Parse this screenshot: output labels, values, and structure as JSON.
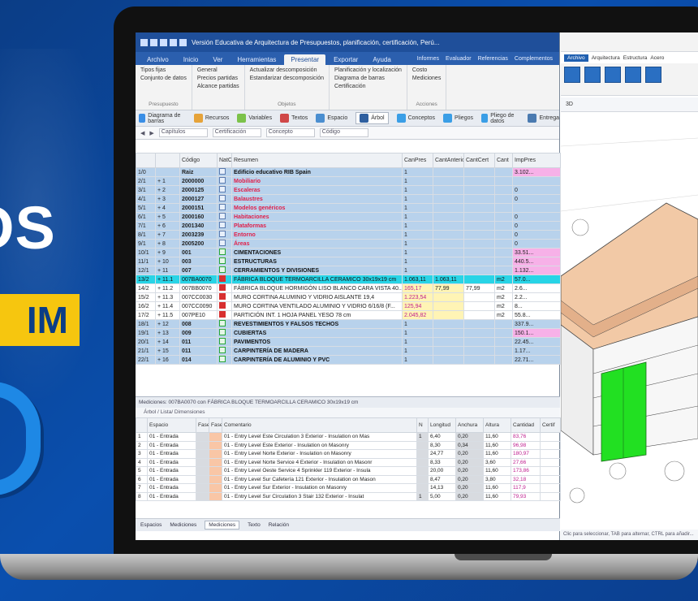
{
  "promo": {
    "headline": "OS",
    "badge": "IM"
  },
  "app": {
    "window_title": "Versión Educativa de Arquitectura de Presupuestos, planificación, certificación, Perú...",
    "menu_tabs": [
      "Archivo",
      "Inicio",
      "Ver",
      "Herramientas",
      "Presentar",
      "Exportar",
      "Ayuda"
    ],
    "active_menu": "Presentar",
    "menu_right": [
      "Informes",
      "Evaluador",
      "Referencias",
      "Complementos"
    ],
    "ribbon_groups": [
      {
        "name": "Presupuesto",
        "items": [
          "Tipos fijas",
          "Conjunto de datos"
        ]
      },
      {
        "name": "",
        "items": [
          "General",
          "Precios partidas",
          "Alcance partidas"
        ]
      },
      {
        "name": "Objetos",
        "items": [
          "Actualizar descomposición",
          "Estandarizar descomposición"
        ]
      },
      {
        "name": "",
        "items": [
          "Planificación y localización",
          "Diagrama de barras",
          "Certificación"
        ]
      },
      {
        "name": "Acciones",
        "items": [
          "Costo",
          "Mediciones"
        ]
      }
    ],
    "doc_tabs": [
      "Diagrama de barras",
      "Recursos",
      "Variables",
      "Textos",
      "Espacio",
      "Árbol",
      "Conceptos",
      "Pliegos",
      "Pliego de datos",
      "Entrega"
    ],
    "active_doc_tab": "Árbol",
    "nav": {
      "field1": "Capítulos",
      "field2": "Certificación",
      "field3": "Concepto",
      "field4": "Código"
    },
    "top_headers": [
      "",
      "",
      "Código",
      "NatC",
      "Resumen",
      "CanPres",
      "CantAnteriorLC",
      "CantCert",
      "Cant",
      "ImpPres"
    ],
    "top_rows": [
      {
        "n": "1/0",
        "lvl": "",
        "code": "Raiz",
        "nat": "blue",
        "desc": "Edificio educativo RIB Spain",
        "style": "chap",
        "txt": "blk",
        "c1": "1",
        "c2": "",
        "c3": "",
        "c4": "",
        "imp": "3.102..."
      },
      {
        "n": "2/1",
        "lvl": "+ 1",
        "code": "2000000",
        "nat": "blue",
        "desc": "Mobiliario",
        "style": "chap",
        "txt": "red",
        "c1": "1",
        "c2": "",
        "c3": "",
        "c4": "",
        "imp": ""
      },
      {
        "n": "3/1",
        "lvl": "+ 2",
        "code": "2000125",
        "nat": "blue",
        "desc": "Escaleras",
        "style": "chap",
        "txt": "red",
        "c1": "1",
        "c2": "",
        "c3": "",
        "c4": "",
        "imp": "0"
      },
      {
        "n": "4/1",
        "lvl": "+ 3",
        "code": "2000127",
        "nat": "blue",
        "desc": "Balaustres",
        "style": "chap",
        "txt": "red",
        "c1": "1",
        "c2": "",
        "c3": "",
        "c4": "",
        "imp": "0"
      },
      {
        "n": "5/1",
        "lvl": "+ 4",
        "code": "2000151",
        "nat": "blue",
        "desc": "Modelos genéricos",
        "style": "chap",
        "txt": "red",
        "c1": "1",
        "c2": "",
        "c3": "",
        "c4": "",
        "imp": ""
      },
      {
        "n": "6/1",
        "lvl": "+ 5",
        "code": "2000160",
        "nat": "blue",
        "desc": "Habitaciones",
        "style": "chap",
        "txt": "red",
        "c1": "1",
        "c2": "",
        "c3": "",
        "c4": "",
        "imp": "0"
      },
      {
        "n": "7/1",
        "lvl": "+ 6",
        "code": "2001340",
        "nat": "blue",
        "desc": "Plataformas",
        "style": "chap",
        "txt": "red",
        "c1": "1",
        "c2": "",
        "c3": "",
        "c4": "",
        "imp": "0"
      },
      {
        "n": "8/1",
        "lvl": "+ 7",
        "code": "2003239",
        "nat": "blue",
        "desc": "Entorno",
        "style": "chap",
        "txt": "red",
        "c1": "1",
        "c2": "",
        "c3": "",
        "c4": "",
        "imp": "0"
      },
      {
        "n": "9/1",
        "lvl": "+ 8",
        "code": "2005200",
        "nat": "blue",
        "desc": "Áreas",
        "style": "chap",
        "txt": "red",
        "c1": "1",
        "c2": "",
        "c3": "",
        "c4": "",
        "imp": "0"
      },
      {
        "n": "10/1",
        "lvl": "+ 9",
        "code": "001",
        "nat": "green",
        "desc": "CIMENTACIONES",
        "style": "chap",
        "txt": "blk",
        "c1": "1",
        "c2": "",
        "c3": "",
        "c4": "",
        "imp": "33.51..."
      },
      {
        "n": "11/1",
        "lvl": "+ 10",
        "code": "003",
        "nat": "green",
        "desc": "ESTRUCTURAS",
        "style": "chap",
        "txt": "blk",
        "c1": "1",
        "c2": "",
        "c3": "",
        "c4": "",
        "imp": "440.5..."
      },
      {
        "n": "12/1",
        "lvl": "+ 11",
        "code": "007",
        "nat": "green",
        "desc": "CERRAMIENTOS Y DIVISIONES",
        "style": "chap",
        "txt": "blk",
        "c1": "1",
        "c2": "",
        "c3": "",
        "c4": "",
        "imp": "1.132..."
      },
      {
        "n": "13/2",
        "lvl": "+ 11.1",
        "code": "007BA0070",
        "nat": "red",
        "desc": "FÁBRICA BLOQUE TERMOARCILLA CERAMICO 30x19x19 cm",
        "style": "sel",
        "txt": "",
        "c1": "1.063,11",
        "c2": "1.063,11",
        "c3": "",
        "c4": "m2",
        "imp": "57.0..."
      },
      {
        "n": "14/2",
        "lvl": "+ 11.2",
        "code": "007BB0070",
        "nat": "red",
        "desc": "FÁBRICA BLOQUE HORMIGÓN LISO BLANCO CARA VISTA 40...",
        "style": "white",
        "txt": "",
        "c1": "165,17",
        "c2": "77,99",
        "c3": "77,99",
        "c4": "m2",
        "imp": "2.6..."
      },
      {
        "n": "15/2",
        "lvl": "+ 11.3",
        "code": "007CC0030",
        "nat": "red",
        "desc": "MURO CORTINA ALUMINIO Y VIDRIO AISLANTE 19,4",
        "style": "white",
        "txt": "",
        "c1": "1.223,54",
        "c2": "",
        "c3": "",
        "c4": "m2",
        "imp": "2.2..."
      },
      {
        "n": "16/2",
        "lvl": "+ 11.4",
        "code": "007CC0090",
        "nat": "red",
        "desc": "MURO CORTINA VENTILADO ALUMINIO Y VIDRIO 6/16/8 (F...",
        "style": "white",
        "txt": "",
        "c1": "125,94",
        "c2": "",
        "c3": "",
        "c4": "m2",
        "imp": "8..."
      },
      {
        "n": "17/2",
        "lvl": "+ 11.5",
        "code": "007PE10",
        "nat": "red",
        "desc": "PARTICIÓN INT. 1 HOJA PANEL YESO 78 cm",
        "style": "white",
        "txt": "",
        "c1": "2.045,82",
        "c2": "",
        "c3": "",
        "c4": "m2",
        "imp": "55.8..."
      },
      {
        "n": "18/1",
        "lvl": "+ 12",
        "code": "008",
        "nat": "green",
        "desc": "REVESTIMIENTOS Y FALSOS TECHOS",
        "style": "chap",
        "txt": "blk",
        "c1": "1",
        "c2": "",
        "c3": "",
        "c4": "",
        "imp": "337.9..."
      },
      {
        "n": "19/1",
        "lvl": "+ 13",
        "code": "009",
        "nat": "green",
        "desc": "CUBIERTAS",
        "style": "chap",
        "txt": "blk",
        "c1": "1",
        "c2": "",
        "c3": "",
        "c4": "",
        "imp": "150.1..."
      },
      {
        "n": "20/1",
        "lvl": "+ 14",
        "code": "011",
        "nat": "green",
        "desc": "PAVIMENTOS",
        "style": "chap",
        "txt": "blk",
        "c1": "1",
        "c2": "",
        "c3": "",
        "c4": "",
        "imp": "22.45..."
      },
      {
        "n": "21/1",
        "lvl": "+ 15",
        "code": "011",
        "nat": "green",
        "desc": "CARPINTERÍA DE MADERA",
        "style": "chap",
        "txt": "blk",
        "c1": "1",
        "c2": "",
        "c3": "",
        "c4": "",
        "imp": "1.17..."
      },
      {
        "n": "22/1",
        "lvl": "+ 16",
        "code": "014",
        "nat": "green",
        "desc": "CARPINTERÍA DE ALUMINIO Y PVC",
        "style": "chap",
        "txt": "blk",
        "c1": "1",
        "c2": "",
        "c3": "",
        "c4": "",
        "imp": "22.71..."
      }
    ],
    "lower_title": "Mediciones: 007BA0070 con FÁBRICA BLOQUE TERMOARCILLA CERAMICO 30x19x19 cm",
    "lower_tool": "Árbol / Lista/ Dimensiones",
    "low_headers": [
      "",
      "Espacio",
      "FaseMed",
      "FaseCert",
      "Comentario",
      "N",
      "Longitud",
      "Anchura",
      "Altura",
      "Cantidad",
      "Certif"
    ],
    "low_rows": [
      {
        "i": "1",
        "esp": "01 - Entrada",
        "c": "01 - Entry Level Este Circulation 3 Exterior - Insulation on Mas",
        "n": "1",
        "l": "6,40",
        "a": "0,20",
        "h": "11,60",
        "q": "83,76"
      },
      {
        "i": "2",
        "esp": "01 - Entrada",
        "c": "01 - Entry Level Este Exterior - Insulation on Masonry",
        "n": "",
        "l": "8,30",
        "a": "0,34",
        "h": "11,60",
        "q": "96,98"
      },
      {
        "i": "3",
        "esp": "01 - Entrada",
        "c": "01 - Entry Level Norte Exterior - Insulation on Masonry",
        "n": "",
        "l": "24,77",
        "a": "0,20",
        "h": "11,60",
        "q": "180,97"
      },
      {
        "i": "4",
        "esp": "01 - Entrada",
        "c": "01 - Entry Level Norte Service 4 Exterior - Insulation on Masonr",
        "n": "",
        "l": "8,33",
        "a": "0,20",
        "h": "3,60",
        "q": "27,66"
      },
      {
        "i": "5",
        "esp": "01 - Entrada",
        "c": "01 - Entry Level Oeste Service 4 Sprinkler 119 Exterior - Insula",
        "n": "",
        "l": "20,00",
        "a": "0,20",
        "h": "11,60",
        "q": "173,86"
      },
      {
        "i": "6",
        "esp": "01 - Entrada",
        "c": "01 - Entry Level Sur Cafetería 121 Exterior - Insulation on Mason",
        "n": "",
        "l": "8,47",
        "a": "0,20",
        "h": "3,80",
        "q": "32,18"
      },
      {
        "i": "7",
        "esp": "01 - Entrada",
        "c": "01 - Entry Level Sur Exterior - Insulation on Masonry",
        "n": "",
        "l": "14,13",
        "a": "0,20",
        "h": "11,60",
        "q": "117,9"
      },
      {
        "i": "8",
        "esp": "01 - Entrada",
        "c": "01 - Entry Level Sur Circulation 3 Stair 132 Exterior - Insulat",
        "n": "1",
        "l": "5,00",
        "a": "0,20",
        "h": "11,60",
        "q": "79,93"
      }
    ],
    "bottom_tabs": [
      "Espacios",
      "Mediciones",
      "Mediciones",
      "Texto",
      "Relación"
    ],
    "active_bottom_tab": "Mediciones"
  },
  "revit": {
    "menu": [
      "Archivo",
      "Arquitectura",
      "Estructura",
      "Acero"
    ],
    "active_menu": "Archivo",
    "view_tab": "3D",
    "status": "Clic para seleccionar, TAB para alternar, CTRL para añadir..."
  },
  "colors": {
    "background": "#0b3d86",
    "badge": "#f6c60f",
    "title_bar": "#1f4f9a",
    "selected_row": "#28d4e6",
    "chapter_row": "#b8d2ec",
    "model_green": "#22e022",
    "roof": "#f2c9a6"
  }
}
